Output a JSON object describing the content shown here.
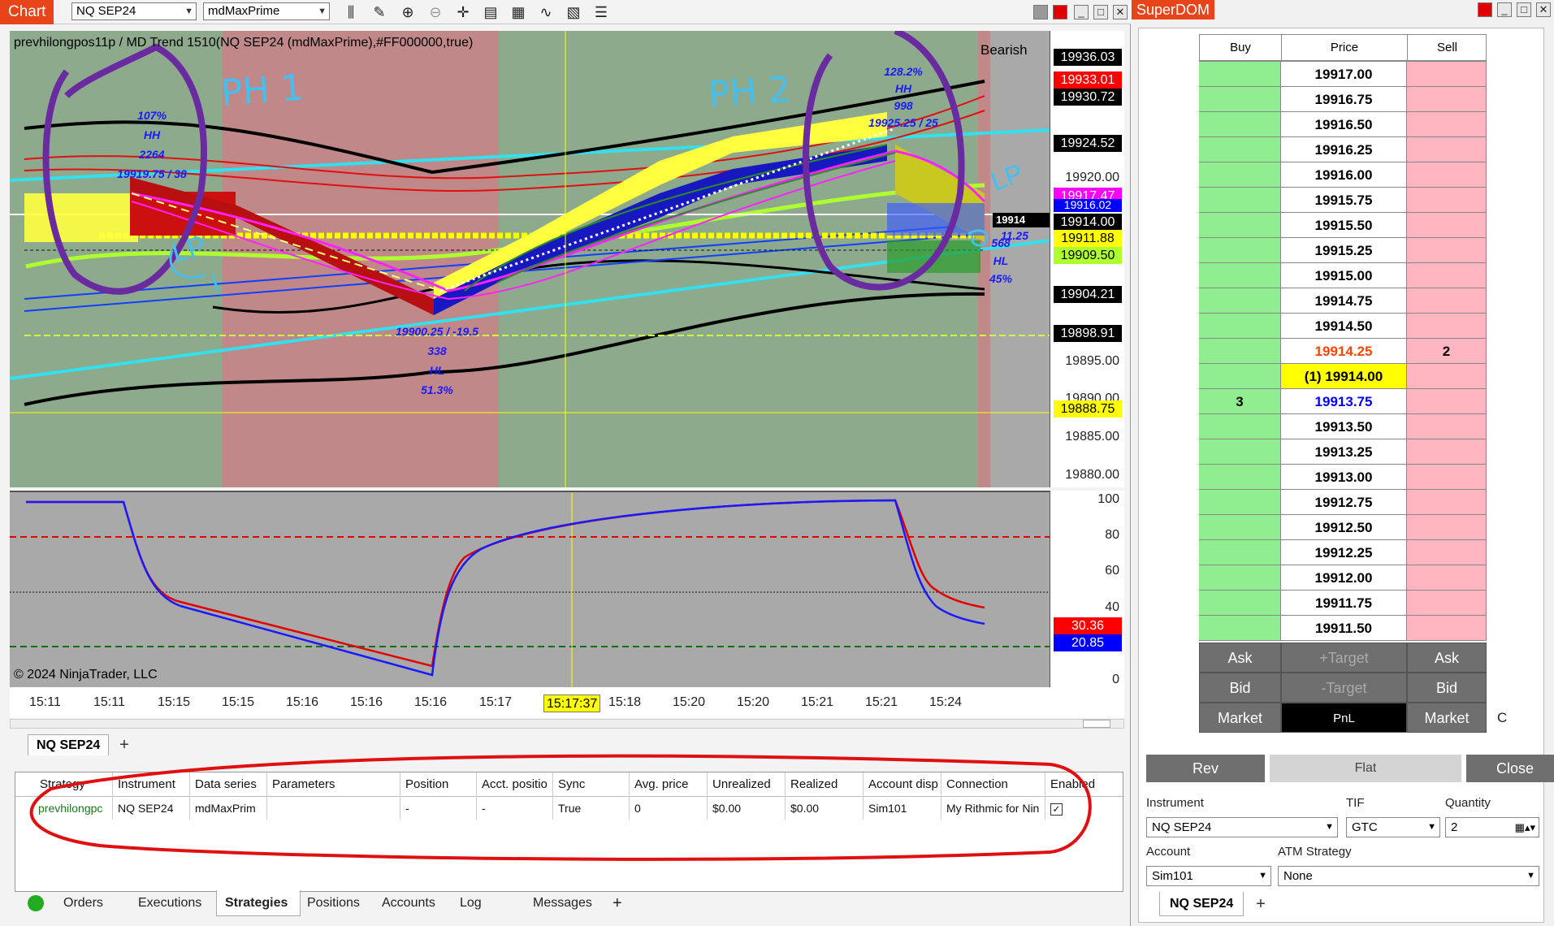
{
  "chart_window": {
    "title": "Chart",
    "instrument": "NQ SEP24",
    "data_series": "mdMaxPrime",
    "indicator_label": "prevhilongpos11p / MD Trend 1510(NQ SEP24 (mdMaxPrime),#FF000000,true)",
    "trend_label": "Bearish",
    "copyright": "© 2024 NinjaTrader, LLC",
    "tab": "NQ SEP24",
    "add_tab": "+"
  },
  "price_axis": {
    "ticks": [
      "19920.00",
      "19895.00",
      "19890.00",
      "19885.00",
      "19880.00"
    ],
    "tags": [
      {
        "text": "19936.03",
        "bg": "#000000",
        "fg": "#ffffff"
      },
      {
        "text": "19933.01",
        "bg": "#ff0000",
        "fg": "#ffffff"
      },
      {
        "text": "19930.72",
        "bg": "#000000",
        "fg": "#ffffff"
      },
      {
        "text": "19924.52",
        "bg": "#000000",
        "fg": "#ffffff"
      },
      {
        "text": "19917.47",
        "bg": "#ff00ff",
        "fg": "#ffffff"
      },
      {
        "text": "19916.02",
        "bg": "#0000ff",
        "fg": "#ffffff"
      },
      {
        "text": "19914.00",
        "bg": "#000000",
        "fg": "#ffffff"
      },
      {
        "text": "19911.88",
        "bg": "#ffff00",
        "fg": "#000000"
      },
      {
        "text": "19909.50",
        "bg": "#adff2f",
        "fg": "#000000"
      },
      {
        "text": "19904.21",
        "bg": "#000000",
        "fg": "#ffffff"
      },
      {
        "text": "19898.91",
        "bg": "#000000",
        "fg": "#ffffff"
      },
      {
        "text": "19888.75",
        "bg": "#ffff00",
        "fg": "#000000"
      }
    ]
  },
  "osc_axis": {
    "ticks": [
      "100",
      "80",
      "60",
      "40",
      "0"
    ],
    "tags": [
      {
        "text": "30.36",
        "bg": "#ff0000",
        "fg": "#ffffff"
      },
      {
        "text": "20.85",
        "bg": "#0000ff",
        "fg": "#ffffff"
      }
    ]
  },
  "time_axis": {
    "labels": [
      "15:11",
      "15:11",
      "15:15",
      "15:15",
      "15:16",
      "15:16",
      "15:16",
      "15:17",
      "15:18",
      "15:20",
      "15:20",
      "15:21",
      "15:21",
      "15:24"
    ],
    "cursor_time": "15:17:37"
  },
  "annotations": {
    "hh1": {
      "pct": "107%",
      "type": "HH",
      "count": "2264",
      "price": "19919.75 / 38"
    },
    "hl1": {
      "price": "19900.25 / -19.5",
      "count": "338",
      "type": "HL",
      "pct": "51.3%"
    },
    "hh2": {
      "pct": "128.2%",
      "type": "HH",
      "count": "998",
      "price": "19925.25 / 25"
    },
    "hl2": {
      "count": "568",
      "type": "HL",
      "pct": "45%",
      "price_frag": "11.25"
    },
    "hand_ph1": "PH 1",
    "hand_ph2": "PH 2",
    "hand_lp1": "LP",
    "hand_lp2": "LP",
    "price_marker": "19914"
  },
  "strategies_table": {
    "columns": [
      "Strategy",
      "Instrument",
      "Data series",
      "Parameters",
      "Position",
      "Acct. positio",
      "Sync",
      "Avg. price",
      "Unrealized",
      "Realized",
      "Account disp",
      "Connection",
      "Enabled"
    ],
    "row": [
      "prevhilongpc",
      "NQ SEP24",
      "mdMaxPrim",
      "",
      "-",
      "-",
      "True",
      "0",
      "$0.00",
      "$0.00",
      "Sim101",
      "My Rithmic for Nin",
      "✓"
    ]
  },
  "bottom_tabs": [
    "Orders",
    "Executions",
    "Strategies",
    "Positions",
    "Accounts",
    "Log",
    "Messages",
    "+"
  ],
  "active_bottom_tab": "Strategies",
  "superdom": {
    "title": "SuperDOM",
    "headers": {
      "buy": "Buy",
      "price": "Price",
      "sell": "Sell"
    },
    "rows": [
      {
        "price": "19917.00",
        "buy": "",
        "sell": ""
      },
      {
        "price": "19916.75",
        "buy": "",
        "sell": ""
      },
      {
        "price": "19916.50",
        "buy": "",
        "sell": ""
      },
      {
        "price": "19916.25",
        "buy": "",
        "sell": ""
      },
      {
        "price": "19916.00",
        "buy": "",
        "sell": ""
      },
      {
        "price": "19915.75",
        "buy": "",
        "sell": ""
      },
      {
        "price": "19915.50",
        "buy": "",
        "sell": ""
      },
      {
        "price": "19915.25",
        "buy": "",
        "sell": ""
      },
      {
        "price": "19915.00",
        "buy": "",
        "sell": ""
      },
      {
        "price": "19914.75",
        "buy": "",
        "sell": ""
      },
      {
        "price": "19914.50",
        "buy": "",
        "sell": ""
      },
      {
        "price": "19914.25",
        "buy": "",
        "sell": "2"
      },
      {
        "price": "(1) 19914.00",
        "buy": "",
        "sell": ""
      },
      {
        "price": "19913.75",
        "buy": "3",
        "sell": ""
      },
      {
        "price": "19913.50",
        "buy": "",
        "sell": ""
      },
      {
        "price": "19913.25",
        "buy": "",
        "sell": ""
      },
      {
        "price": "19913.00",
        "buy": "",
        "sell": ""
      },
      {
        "price": "19912.75",
        "buy": "",
        "sell": ""
      },
      {
        "price": "19912.50",
        "buy": "",
        "sell": ""
      },
      {
        "price": "19912.25",
        "buy": "",
        "sell": ""
      },
      {
        "price": "19912.00",
        "buy": "",
        "sell": ""
      },
      {
        "price": "19911.75",
        "buy": "",
        "sell": ""
      },
      {
        "price": "19911.50",
        "buy": "",
        "sell": ""
      }
    ],
    "buttons": {
      "ask_left": "Ask",
      "target_plus": "+Target",
      "ask_right": "Ask",
      "bid_left": "Bid",
      "target_minus": "-Target",
      "bid_right": "Bid",
      "market_left": "Market",
      "pnl": "PnL",
      "market_right": "Market",
      "side_c": "C"
    },
    "actions": {
      "rev": "Rev",
      "flat": "Flat",
      "close": "Close"
    },
    "form": {
      "instrument_label": "Instrument",
      "instrument_value": "NQ SEP24",
      "tif_label": "TIF",
      "tif_value": "GTC",
      "quantity_label": "Quantity",
      "quantity_value": "2",
      "account_label": "Account",
      "account_value": "Sim101",
      "atm_label": "ATM Strategy",
      "atm_value": "None"
    },
    "tab": "NQ SEP24",
    "add_tab": "+"
  },
  "colors": {
    "chart_tab_bg": "#e8441a",
    "dom_tab_bg": "#e8441a",
    "bull_zone": "#8daa8d",
    "bear_zone": "#c08888",
    "buy_cell": "#90ee90",
    "sell_cell": "#ffb6c1",
    "best_ask": "#ff4500",
    "best_bid": "#0000ff",
    "last_trade_bg": "#ffff00",
    "annotation_red": "#e01010",
    "annotation_purple": "#6a2aa0"
  }
}
